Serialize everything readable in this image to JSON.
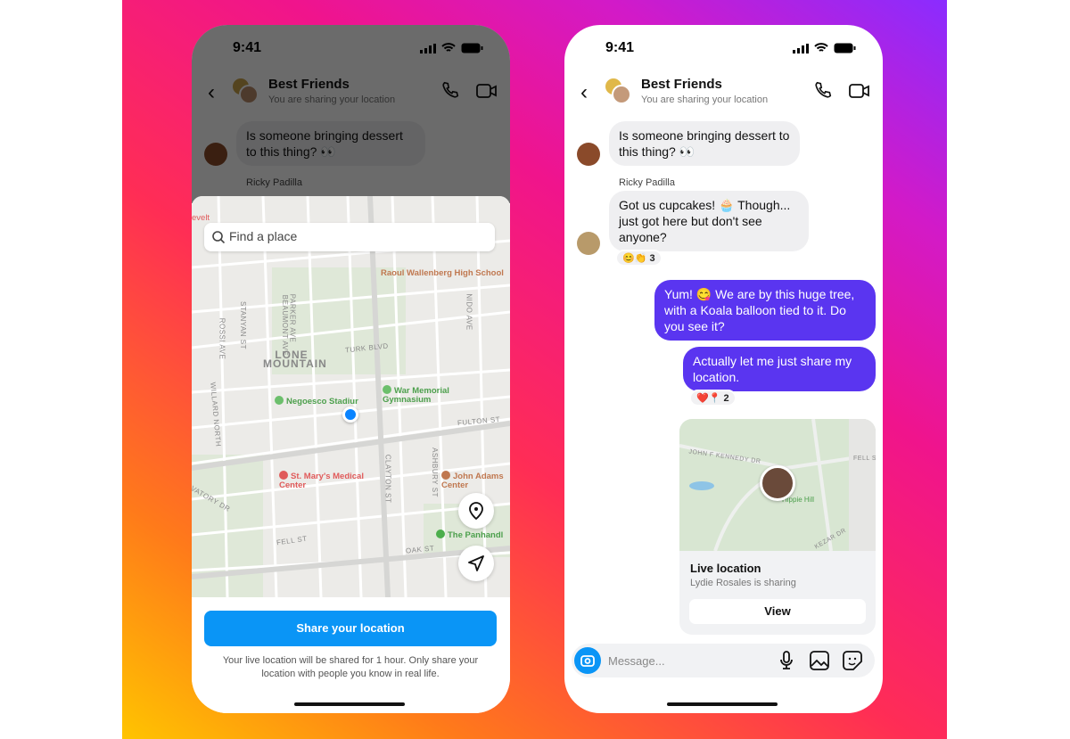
{
  "status_time": "9:41",
  "chat": {
    "title": "Best Friends",
    "subtitle": "You are sharing your location"
  },
  "messages": [
    {
      "text": "Is someone bringing dessert to this thing? 👀"
    },
    {
      "sender": "Ricky Padilla",
      "text": "Got us cupcakes! 🧁 Though... just got here but don't see anyone?",
      "reactions": "😊👏 3"
    },
    {
      "text": "Yum! 😋 We are by this huge tree, with a Koala balloon tied to it. Do you see it?"
    },
    {
      "text": "Actually let me just share my location.",
      "reactions": "❤️📍 2"
    }
  ],
  "location_sheet": {
    "search_placeholder": "Find a place",
    "map_labels": {
      "school": "Raoul Wallenberg High School",
      "neighborhood": "LONE MOUNTAIN",
      "stadium": "Negoesco Stadiur",
      "gym": "War Memorial Gymnasium",
      "hospital": "St. Mary's Medical Center",
      "center": "John Adams Center",
      "panhandle": "The Panhandl",
      "turk": "TURK BLVD",
      "fulton": "FULTON ST",
      "fell": "FELL ST",
      "oak": "OAK ST",
      "stanyan": "STANYAN ST",
      "parker": "PARKER AVE",
      "beaumont": "BEAUMONT AVE",
      "nido": "NIDO AVE",
      "clayton": "CLAYTON ST",
      "ashbury": "ASHBURY ST",
      "willard": "WILLARD NORTH",
      "rossi": "ROSSI AVE",
      "roosevelt": "evelt",
      "conservatory": "VATORY DR"
    },
    "share_button": "Share your location",
    "disclaimer": "Your live location will be shared for 1 hour. Only share your location with people you know in real life."
  },
  "live_location": {
    "title": "Live location",
    "subtitle": "Lydie Rosales is sharing",
    "view_button": "View",
    "map_labels": {
      "place": "Hippie Hill",
      "jfk": "JOHN F KENNEDY DR",
      "kezar": "KEZAR DR",
      "fell": "FELL S"
    }
  },
  "composer": {
    "placeholder": "Message..."
  },
  "colors": {
    "outgoing_bubble": "#5a35f0",
    "primary_button": "#0a95f6",
    "location_dot": "#0a84ff"
  }
}
